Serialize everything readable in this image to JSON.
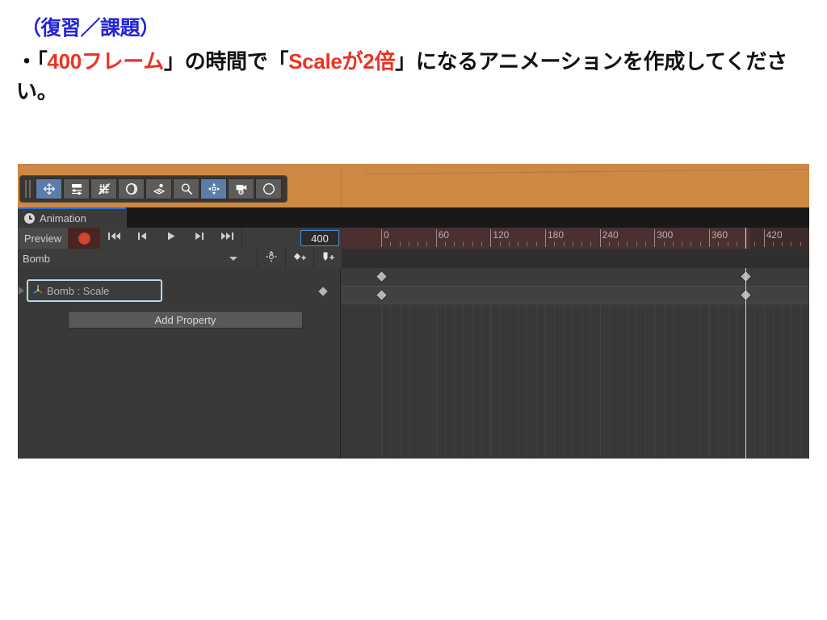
{
  "slide": {
    "heading": "（復習／課題）",
    "body_prefix": "・",
    "body_q1_open": "「",
    "body_q1": "400フレーム",
    "body_q1_close": "」",
    "body_mid": "の時間で",
    "body_q2_open": "「",
    "body_q2": "Scaleが2倍",
    "body_q2_close": "」",
    "body_suffix": "になるアニメーションを作成してください。",
    "heading_color": "#2324d8",
    "accent_color": "#ea3323"
  },
  "unity": {
    "scene_background_color": "#cd8844",
    "toolbar": {
      "tools": [
        {
          "name": "move-tool",
          "active": true
        },
        {
          "name": "sliders-tool",
          "active": false
        },
        {
          "name": "grid-snap-tool",
          "active": false
        },
        {
          "name": "sphere-tool",
          "active": false
        },
        {
          "name": "layers-tool",
          "active": false
        },
        {
          "name": "search-tool",
          "active": false
        },
        {
          "name": "gizmo-move-tool",
          "active": true
        },
        {
          "name": "camera-tool",
          "active": false
        },
        {
          "name": "compass-tool",
          "active": false
        }
      ]
    },
    "tab": {
      "label": "Animation",
      "icon": "clock-icon",
      "active_border_color": "#2c6fcf"
    },
    "controls": {
      "preview_label": "Preview",
      "record_label": "record-button",
      "first_frame_label": "first-frame",
      "prev_frame_label": "previous-keyframe",
      "play_label": "play",
      "next_frame_label": "next-keyframe",
      "last_frame_label": "last-frame",
      "frame_value": "400"
    },
    "object_row": {
      "selected_clip": "Bomb",
      "tools": [
        "filter-toggle",
        "add-keyframe",
        "add-event"
      ]
    },
    "properties": {
      "rows": [
        {
          "label": "Bomb : Scale",
          "selected": true,
          "icon": "transform-axis-icon"
        }
      ],
      "add_property_label": "Add Property"
    },
    "timeline": {
      "tick_labels": [
        "0",
        "60",
        "120",
        "180",
        "240",
        "300",
        "360",
        "420"
      ],
      "tick_frames": [
        0,
        60,
        120,
        180,
        240,
        300,
        360,
        420
      ],
      "frames_per_pixel_start": 0,
      "playhead_frame": 400,
      "visible_end_frame": 460,
      "keyframe_rows": [
        {
          "name": "summary-row",
          "frames": [
            0,
            400
          ]
        },
        {
          "name": "scale-row",
          "frames": [
            0,
            400
          ]
        }
      ]
    }
  }
}
